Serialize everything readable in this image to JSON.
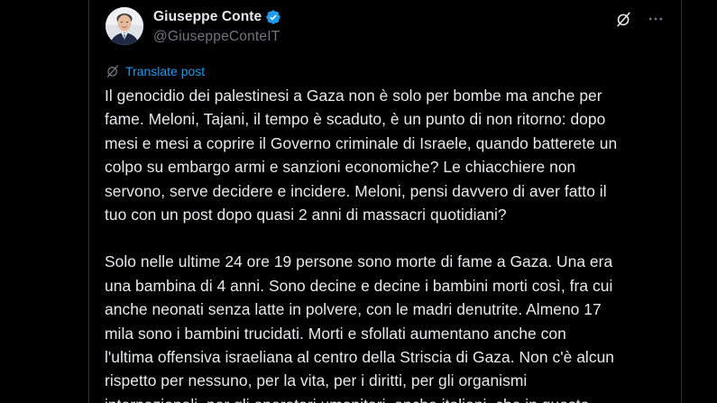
{
  "author": {
    "name": "Giuseppe Conte",
    "handle": "@GiuseppeConteIT",
    "verified": true
  },
  "header": {
    "grok_icon": "grok-slash-icon",
    "more_icon": "more-dots-icon",
    "more_label": "···"
  },
  "translate": {
    "icon": "translate-icon",
    "label": "Translate post"
  },
  "post": {
    "paragraphs": [
      "Il genocidio dei palestinesi a Gaza non è solo per bombe ma anche per\nfame. Meloni, Tajani, il tempo è scaduto, è un punto di non ritorno: dopo\nmesi e mesi a coprire il Governo criminale di Israele, quando batterete un\ncolpo su embargo armi e sanzioni economiche? Le chiacchiere non\nservono, serve decidere  e incidere. Meloni, pensi davvero di aver fatto il\ntuo con un post dopo quasi 2 anni di massacri quotidiani?",
      "Solo nelle ultime 24 ore 19 persone sono morte di fame a Gaza. Una era\nuna bambina di 4 anni. Sono decine e decine i bambini morti così, fra cui\nanche neonati senza latte in polvere, con le madri denutrite. Almeno 17\nmila sono i bambini trucidati. Morti e sfollati aumentano anche con\nl'ultima offensiva israeliana al centro della Striscia di Gaza. Non c'è alcun\nrispetto per nessuno, per la vita, per i diritti, per gli organismi\ninternazionali, per gli operatori umanitari, anche italiani, che in questo"
    ]
  },
  "colors": {
    "background": "#000000",
    "text": "#e7e9ea",
    "secondary": "#71767b",
    "accent": "#1d9bf0",
    "border": "#2f3336"
  }
}
